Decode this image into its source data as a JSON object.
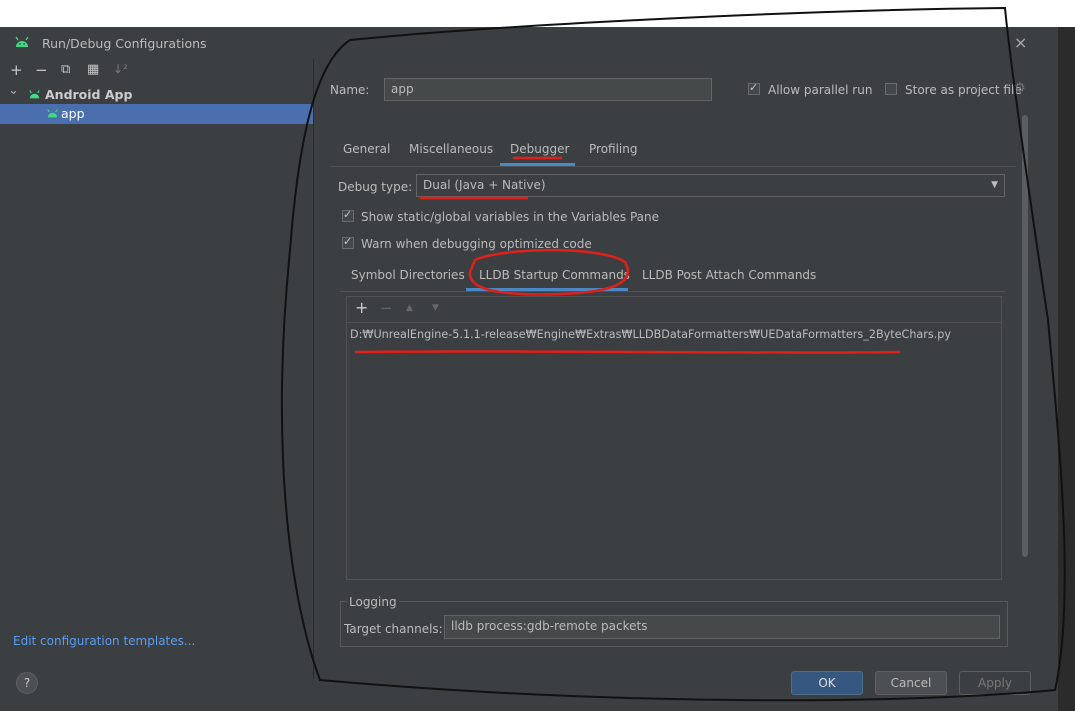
{
  "window": {
    "title": "Run/Debug Configurations",
    "close_glyph": "×"
  },
  "toolbar": {
    "add": "+",
    "remove": "−",
    "copy": "⧉",
    "folder": "▦",
    "sort": "↓²"
  },
  "tree": {
    "group": {
      "label": "Android App",
      "expander": "⌄"
    },
    "item": {
      "label": "app"
    }
  },
  "footer_left": {
    "templates_link": "Edit configuration templates...",
    "help": "?"
  },
  "form": {
    "name_label": "Name:",
    "name_value": "app",
    "allow_parallel_label": "Allow parallel run",
    "allow_parallel_checked": true,
    "store_project_label": "Store as project file",
    "store_project_checked": false
  },
  "tabs": [
    "General",
    "Miscellaneous",
    "Debugger",
    "Profiling"
  ],
  "active_tab": "Debugger",
  "debugger": {
    "debug_type_label": "Debug type:",
    "debug_type_value": "Dual (Java + Native)",
    "show_static_label": "Show static/global variables in the Variables Pane",
    "warn_optimized_label": "Warn when debugging optimized code",
    "subtabs": [
      "Symbol Directories",
      "LLDB Startup Commands",
      "LLDB Post Attach Commands"
    ],
    "active_subtab": "LLDB Startup Commands",
    "list_toolbar": {
      "add": "+",
      "remove": "−",
      "up": "▲",
      "down": "▼"
    },
    "commands": [
      "D:₩UnrealEngine-5.1.1-release₩Engine₩Extras₩LLDBDataFormatters₩UEDataFormatters_2ByteChars.py"
    ],
    "logging_title": "Logging",
    "target_channels_label": "Target channels:",
    "target_channels_value": "lldb process:gdb-remote packets"
  },
  "buttons": {
    "ok": "OK",
    "cancel": "Cancel",
    "apply": "Apply"
  },
  "colors": {
    "accent": "#4a88c7",
    "selection": "#4b6eaf",
    "annotation_red": "#e0201b",
    "android_green": "#3ddc84"
  }
}
